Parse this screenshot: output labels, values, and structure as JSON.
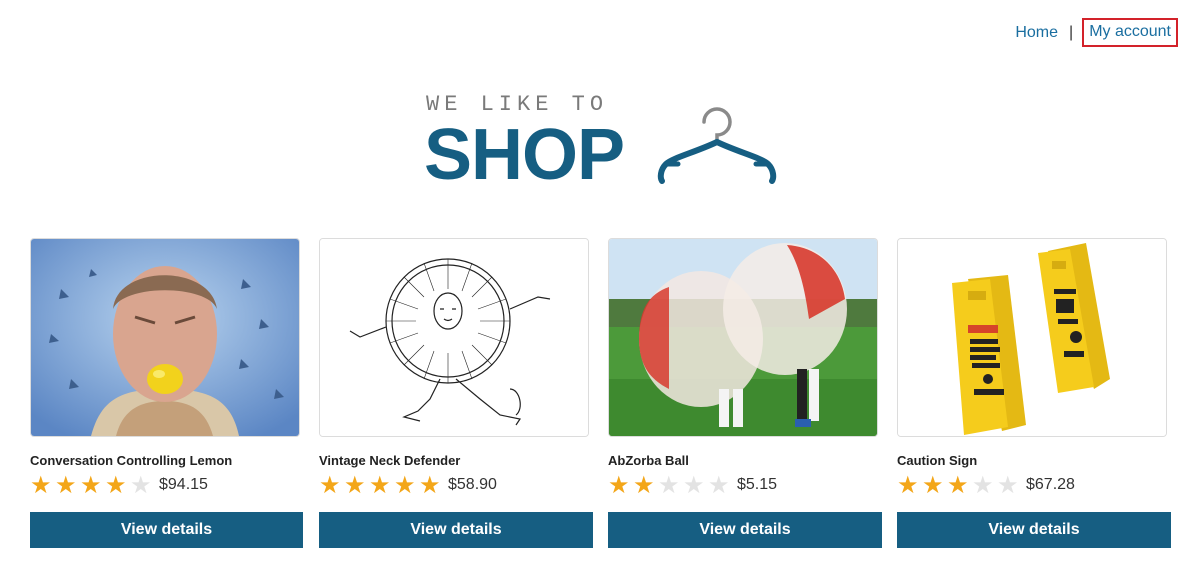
{
  "nav": {
    "home_label": "Home",
    "separator": "|",
    "account_label": "My account"
  },
  "logo": {
    "tagline": "WE LIKE TO",
    "brand": "SHOP",
    "icon": "hanger-icon"
  },
  "colors": {
    "brand": "#165e82",
    "link": "#1a6ea0",
    "highlight_border": "#d3222a",
    "star_on": "#f3a619",
    "star_off": "#e3e3e3"
  },
  "products": [
    {
      "name": "Conversation Controlling Lemon",
      "rating": 4,
      "rating_max": 5,
      "price": "$94.15",
      "button_label": "View details",
      "image": "man-biting-lemon-photo"
    },
    {
      "name": "Vintage Neck Defender",
      "rating": 5,
      "rating_max": 5,
      "price": "$58.90",
      "button_label": "View details",
      "image": "vintage-neck-ruff-illustration"
    },
    {
      "name": "AbZorba Ball",
      "rating": 2,
      "rating_max": 5,
      "price": "$5.15",
      "button_label": "View details",
      "image": "bubble-soccer-photo"
    },
    {
      "name": "Caution Sign",
      "rating": 3,
      "rating_max": 5,
      "price": "$67.28",
      "button_label": "View details",
      "image": "yellow-caution-signs-photo"
    }
  ]
}
